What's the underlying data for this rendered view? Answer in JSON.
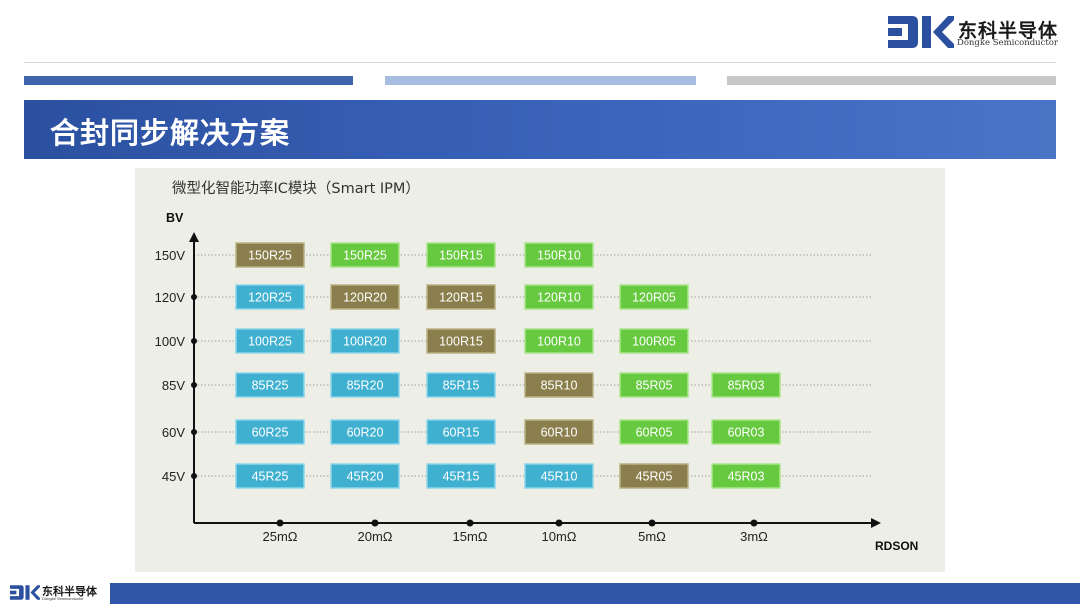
{
  "header": {
    "logo_cn": "东科半导体",
    "logo_en": "Dongke Semiconductor",
    "title": "合封同步解决方案"
  },
  "panel": {
    "title": "微型化智能功率IC模块（Smart IPM）"
  },
  "colors": {
    "accent_blue": "#2b50a0",
    "cell_blue": "#3fb0cf",
    "cell_green": "#66c93f",
    "cell_olive": "#8a7f4c",
    "panel_bg": "#edefe6"
  },
  "chart_data": {
    "type": "table",
    "ylabel": "BV",
    "xlabel": "RDSON",
    "y_categories": [
      "150V",
      "120V",
      "100V",
      "85V",
      "60V",
      "45V"
    ],
    "x_categories": [
      "25mΩ",
      "20mΩ",
      "15mΩ",
      "10mΩ",
      "5mΩ",
      "3mΩ"
    ],
    "legend": "none",
    "grid": "dotted horizontal lines",
    "cells": [
      [
        {
          "label": "150R25",
          "color": "olive"
        },
        {
          "label": "150R25",
          "color": "green"
        },
        {
          "label": "150R15",
          "color": "green"
        },
        {
          "label": "150R10",
          "color": "green"
        },
        null,
        null
      ],
      [
        {
          "label": "120R25",
          "color": "blue"
        },
        {
          "label": "120R20",
          "color": "olive"
        },
        {
          "label": "120R15",
          "color": "olive"
        },
        {
          "label": "120R10",
          "color": "green"
        },
        {
          "label": "120R05",
          "color": "green"
        },
        null
      ],
      [
        {
          "label": "100R25",
          "color": "blue"
        },
        {
          "label": "100R20",
          "color": "blue"
        },
        {
          "label": "100R15",
          "color": "olive"
        },
        {
          "label": "100R10",
          "color": "green"
        },
        {
          "label": "100R05",
          "color": "green"
        },
        null
      ],
      [
        {
          "label": "85R25",
          "color": "blue"
        },
        {
          "label": "85R20",
          "color": "blue"
        },
        {
          "label": "85R15",
          "color": "blue"
        },
        {
          "label": "85R10",
          "color": "olive"
        },
        {
          "label": "85R05",
          "color": "green"
        },
        {
          "label": "85R03",
          "color": "green"
        }
      ],
      [
        {
          "label": "60R25",
          "color": "blue"
        },
        {
          "label": "60R20",
          "color": "blue"
        },
        {
          "label": "60R15",
          "color": "blue"
        },
        {
          "label": "60R10",
          "color": "olive"
        },
        {
          "label": "60R05",
          "color": "green"
        },
        {
          "label": "60R03",
          "color": "green"
        }
      ],
      [
        {
          "label": "45R25",
          "color": "blue"
        },
        {
          "label": "45R20",
          "color": "blue"
        },
        {
          "label": "45R15",
          "color": "blue"
        },
        {
          "label": "45R10",
          "color": "blue"
        },
        {
          "label": "45R05",
          "color": "olive"
        },
        {
          "label": "45R03",
          "color": "green"
        }
      ]
    ]
  }
}
